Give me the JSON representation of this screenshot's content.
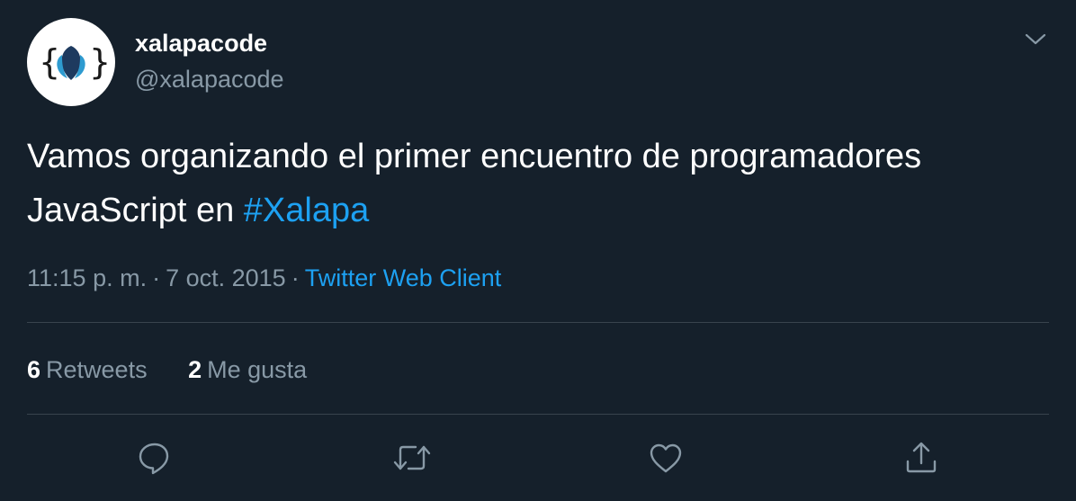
{
  "user": {
    "display_name": "xalapacode",
    "handle": "@xalapacode"
  },
  "tweet": {
    "text_before": "Vamos organizando el primer encuentro de programadores JavaScript en ",
    "hashtag": "#Xalapa"
  },
  "meta": {
    "time": "11:15 p. m.",
    "separator": "·",
    "date": "7 oct. 2015",
    "source": "Twitter Web Client"
  },
  "stats": {
    "retweets_count": "6",
    "retweets_label": "Retweets",
    "likes_count": "2",
    "likes_label": "Me gusta"
  },
  "icons": {
    "caret": "chevron-down-icon",
    "reply": "reply-icon",
    "retweet": "retweet-icon",
    "like": "heart-icon",
    "share": "share-icon"
  },
  "colors": {
    "background": "#15202b",
    "accent": "#1da1f2",
    "secondary_text": "#8899a6",
    "divider": "#38444d"
  }
}
